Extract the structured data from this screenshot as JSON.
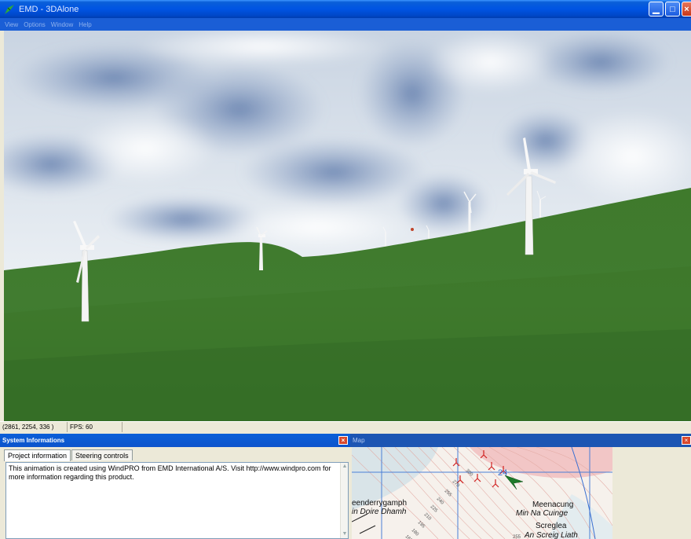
{
  "window": {
    "title": "EMD - 3DAlone"
  },
  "menu": [
    "View",
    "Options",
    "Window",
    "Help"
  ],
  "status": {
    "coords": "(2861, 2254, 336 )",
    "fps": "FPS: 60"
  },
  "system_panel": {
    "title": "System Informations",
    "tabs": [
      "Project information",
      "Steering controls"
    ],
    "text": "This animation is created using WindPRO from EMD International A/S. Visit http://www.windpro.com for more information regarding this product."
  },
  "map_panel": {
    "title": "Map",
    "place_labels": [
      "eenderrygamph",
      "in Doire Dhamh",
      "Meenacung",
      "Min Na Cuinge",
      "Screglea",
      "An Screig Liath"
    ],
    "contour_labels": [
      "300",
      "270",
      "255",
      "240",
      "225",
      "210",
      "195",
      "180",
      "165",
      "255"
    ],
    "marker_label": "24"
  },
  "colors": {
    "titlebar": "#0054e3",
    "grass": "#3e7a2a",
    "sky": "#dfe6ee",
    "map_pink": "#f2c6c6",
    "map_blue": "#3a6fd1"
  }
}
